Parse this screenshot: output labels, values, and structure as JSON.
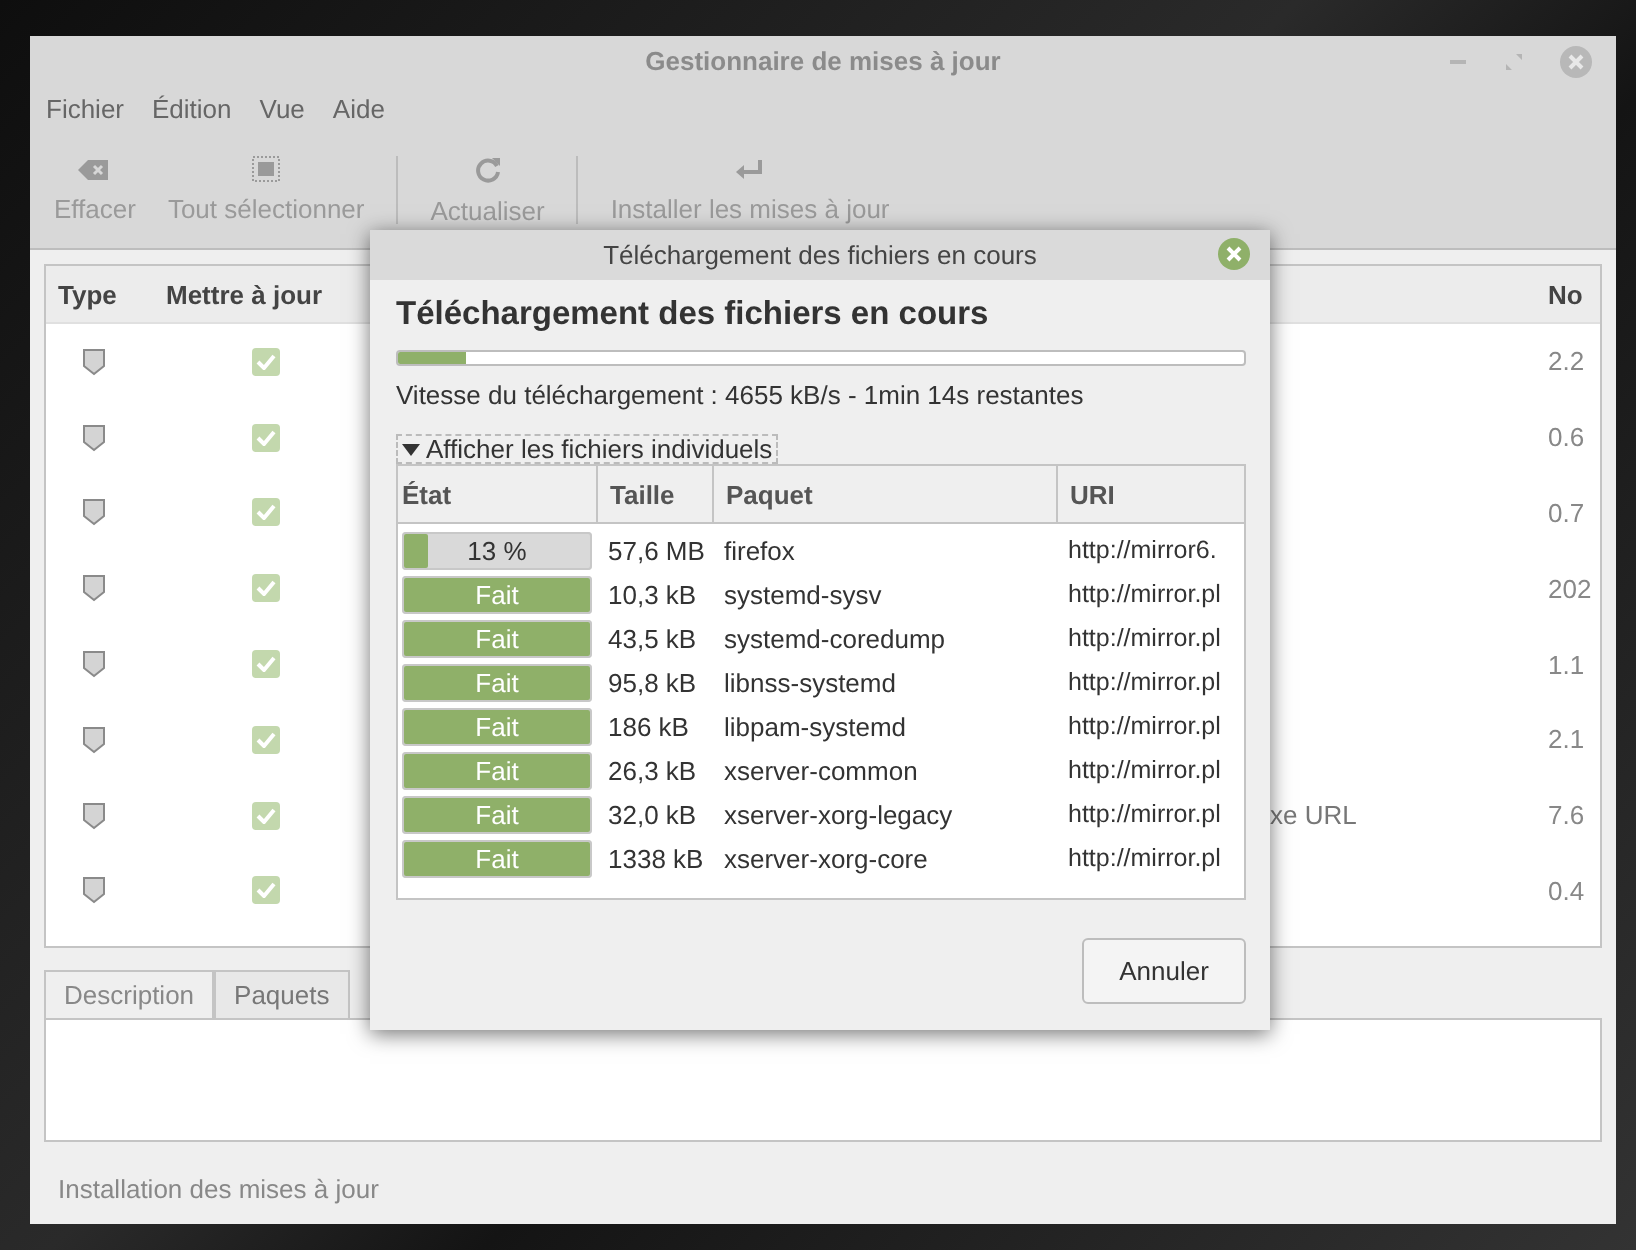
{
  "window": {
    "title": "Gestionnaire de mises à jour"
  },
  "menu": [
    "Fichier",
    "Édition",
    "Vue",
    "Aide"
  ],
  "toolbar": [
    {
      "kind": "clear",
      "label": "Effacer",
      "disabled": true
    },
    {
      "kind": "select-all",
      "label": "Tout sélectionner",
      "disabled": true
    },
    {
      "kind": "refresh",
      "label": "Actualiser",
      "disabled": true
    },
    {
      "kind": "install",
      "label": "Installer les mises à jour",
      "disabled": true
    }
  ],
  "updates": {
    "columns": [
      "Type",
      "Mettre à jour",
      "No"
    ],
    "rows": [
      {
        "checked": true,
        "column_4": "2.2"
      },
      {
        "checked": true,
        "column_4": "0.6"
      },
      {
        "checked": true,
        "column_4": "0.7"
      },
      {
        "checked": true,
        "column_4": "202"
      },
      {
        "checked": true,
        "column_4": "1.1"
      },
      {
        "checked": true,
        "column_4": "2.1"
      },
      {
        "checked": true,
        "column_3": "xe URL",
        "column_4": "7.6"
      },
      {
        "checked": true,
        "column_4": "0.4"
      }
    ]
  },
  "tabs": [
    {
      "label": "Description",
      "selected": true
    },
    {
      "label": "Paquets",
      "selected": false
    }
  ],
  "status_bar": "Installation des mises à jour",
  "dialog": {
    "title": "Téléchargement des fichiers en cours",
    "heading": "Téléchargement des fichiers en cours",
    "level": 0.08,
    "speed": "Vitesse du téléchargement : 4655 kB/s - 1min 14s restantes",
    "expander": {
      "label": "Afficher les fichiers individuels",
      "expanded": true
    },
    "columns": [
      "État",
      "Taille",
      "Paquet",
      "URI"
    ],
    "rows": [
      {
        "status": "13 %",
        "level": 0.13,
        "size": "57,6 MB",
        "package": "firefox",
        "uri": "http://mirror6."
      },
      {
        "status": "Fait",
        "level": 1,
        "size": "10,3 kB",
        "package": "systemd-sysv",
        "uri": "http://mirror.pl"
      },
      {
        "status": "Fait",
        "level": 1,
        "size": "43,5 kB",
        "package": "systemd-coredump",
        "uri": "http://mirror.pl"
      },
      {
        "status": "Fait",
        "level": 1,
        "size": "95,8 kB",
        "package": "libnss-systemd",
        "uri": "http://mirror.pl"
      },
      {
        "status": "Fait",
        "level": 1,
        "size": "186 kB",
        "package": "libpam-systemd",
        "uri": "http://mirror.pl"
      },
      {
        "status": "Fait",
        "level": 1,
        "size": "26,3 kB",
        "package": "xserver-common",
        "uri": "http://mirror.pl"
      },
      {
        "status": "Fait",
        "level": 1,
        "size": "32,0 kB",
        "package": "xserver-xorg-legacy",
        "uri": "http://mirror.pl"
      },
      {
        "status": "Fait",
        "level": 1,
        "size": "1338 kB",
        "package": "xserver-xorg-core",
        "uri": "http://mirror.pl"
      }
    ],
    "buttons": [
      "Annuler"
    ]
  }
}
